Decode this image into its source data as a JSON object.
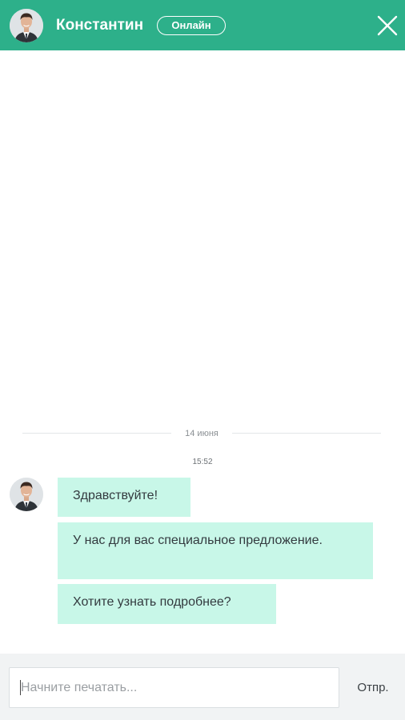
{
  "header": {
    "agent_name": "Константин",
    "status_label": "Онлайн",
    "avatar_icon": "agent-avatar",
    "close_icon": "close-icon",
    "background_color": "#2db08a"
  },
  "conversation": {
    "date_label": "14 июня",
    "time_label": "15:52",
    "messages": [
      {
        "text": "Здравствуйте!"
      },
      {
        "text": "У нас для вас специальное предложение."
      },
      {
        "text": "Хотите узнать подробнее?"
      }
    ],
    "bubble_color": "#c8f7e8"
  },
  "composer": {
    "input_value": "",
    "input_placeholder": "Начните печатать...",
    "send_label": "Отпр."
  }
}
